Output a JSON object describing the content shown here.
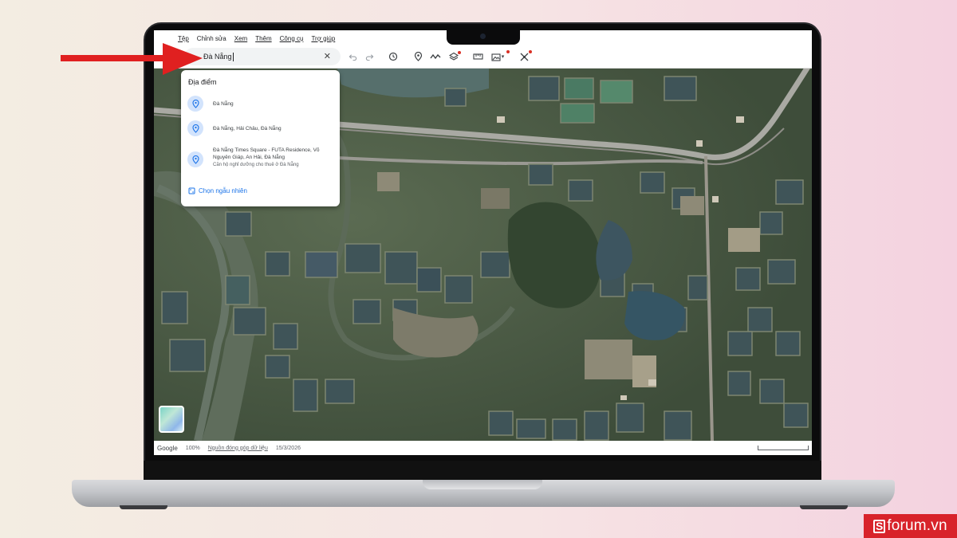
{
  "menu": {
    "items": [
      "Tệp",
      "Chỉnh sửa",
      "Xem",
      "Thêm",
      "Công cụ",
      "Trợ giúp"
    ]
  },
  "search": {
    "value": "Đà Nẵng",
    "clear_icon": "close-icon"
  },
  "toolbar": {
    "icons": [
      "undo-icon",
      "redo-icon",
      "history-icon",
      "placemark-icon",
      "path-icon",
      "layers-icon",
      "ruler-icon",
      "photo-icon",
      "measure-icon"
    ]
  },
  "dropdown": {
    "header": "Địa điểm",
    "items": [
      {
        "title": "Đà Nẵng",
        "subtitle": ""
      },
      {
        "title": "Đà Nẵng, Hải Châu, Đà Nẵng",
        "subtitle": ""
      },
      {
        "title": "Đà Nẵng Times Square - FUTA Residence, Võ Nguyên Giáp, An Hải, Đà Nẵng",
        "subtitle": "Căn hộ nghỉ dưỡng cho thuê ở Đà Nẵng"
      }
    ],
    "random_label": "Chọn ngẫu nhiên"
  },
  "statusbar": {
    "logo": "Google",
    "zoom": "100%",
    "contribute_link": "Nguồn đóng góp dữ liệu",
    "date": "15/3/2026"
  },
  "watermark": {
    "letter": "S",
    "text": "forum.vn"
  },
  "colors": {
    "accent": "#1a73e8",
    "arrow": "#e02020",
    "watermark_bg": "#d8232a"
  }
}
